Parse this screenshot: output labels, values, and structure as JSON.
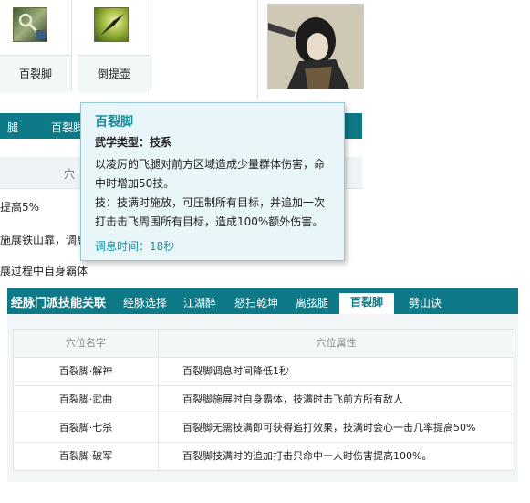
{
  "top_strip": {
    "skills": [
      {
        "label": "百裂脚",
        "icon": "staff-skill-icon"
      },
      {
        "label": "倒提壶",
        "icon": "spin-skill-icon"
      }
    ],
    "portrait": "character-portrait"
  },
  "upper_tabs": [
    "腿",
    "百裂脚"
  ],
  "upper_rows": [
    "提高5%",
    "施展铁山靠，调息",
    "展过程中自身霸体"
  ],
  "tooltip": {
    "title": "百裂脚",
    "type": "武学类型：技系",
    "desc_lines": [
      "以凌厉的飞腿对前方区域造成少量群体伤害，命",
      "中时增加50技。",
      "技：技满时施放，可压制所有目标，并追加一次",
      "打击击飞周围所有目标，造成100%额外伤害。"
    ],
    "cooldown": "调息时间：18秒"
  },
  "panel": {
    "heading": "经脉门派技能关联",
    "tabs": [
      {
        "label": "经脉选择",
        "active": false
      },
      {
        "label": "江湖醉",
        "active": false
      },
      {
        "label": "怒扫乾坤",
        "active": false
      },
      {
        "label": "离弦腿",
        "active": false
      },
      {
        "label": "百裂脚",
        "active": true
      },
      {
        "label": "劈山诀",
        "active": false
      }
    ],
    "columns": [
      "穴位名字",
      "穴位属性"
    ],
    "rows": [
      {
        "name": "百裂脚·解神",
        "attr": "百裂脚调息时间降低1秒"
      },
      {
        "name": "百裂脚·武曲",
        "attr": "百裂脚施展时自身霸体，技满时击飞前方所有敌人"
      },
      {
        "name": "百裂脚·七杀",
        "attr": "百裂脚无需技满即可获得追打效果，技满时会心一击几率提高50%"
      },
      {
        "name": "百裂脚·破军",
        "attr": "百裂脚技满时的追加打击只命中一人时伤害提高100%。"
      }
    ]
  }
}
